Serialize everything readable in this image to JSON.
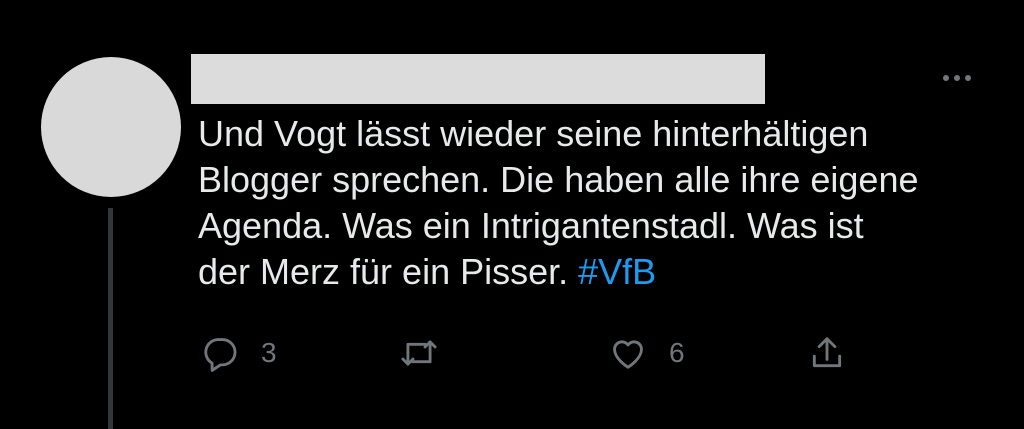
{
  "tweet": {
    "text_lines": [
      "Und Vogt lässt wieder seine hinterhältigen",
      "Blogger sprechen. Die haben alle ihre eigene",
      "Agenda. Was ein Intrigantenstadl. Was ist",
      "der Merz für ein Pisser. "
    ],
    "hashtag": "#VfB",
    "reply_count": "3",
    "retweet_count": "",
    "like_count": "6"
  },
  "icons": {
    "more": "more-horizontal-icon",
    "reply": "reply-bubble-icon",
    "retweet": "retweet-icon",
    "like": "heart-icon",
    "share": "share-upload-icon"
  },
  "colors": {
    "background": "#000000",
    "text": "#e7e9ea",
    "hashtag": "#1d9bf0",
    "muted": "#71767b",
    "redaction": "#dcdcdc",
    "avatar": "#d9d9d9"
  }
}
